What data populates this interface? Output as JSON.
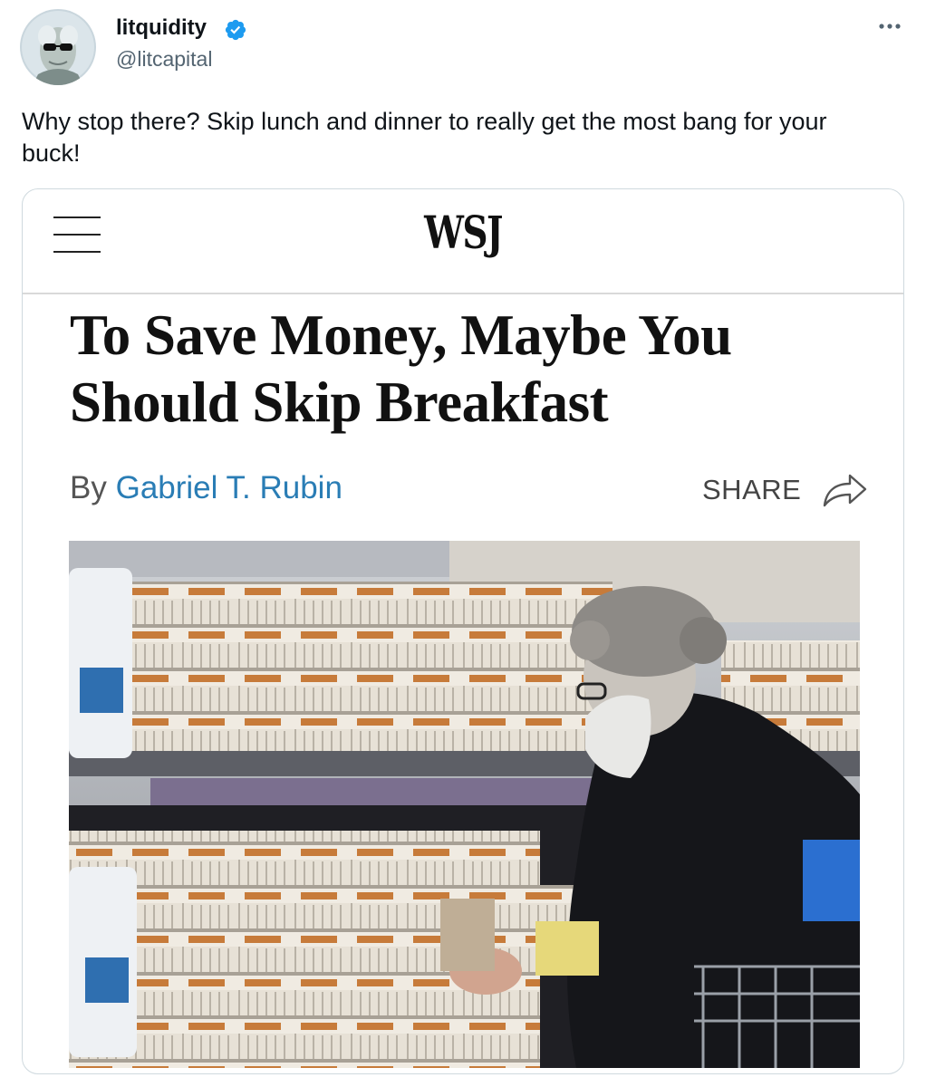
{
  "tweet": {
    "author": {
      "display_name": "litquidity",
      "handle": "@litcapital",
      "verified": true,
      "avatar_icon": "avatar-sunglasses-icon"
    },
    "text": "Why stop there? Skip lunch and dinner to really get the most bang for your buck!",
    "more_icon": "more-options-icon"
  },
  "article_card": {
    "publication": "WSJ",
    "menu_icon": "hamburger-menu-icon",
    "headline": "To Save Money, Maybe You Should Skip Breakfast",
    "byline_prefix": "By",
    "author": "Gabriel T. Rubin",
    "share_label": "SHARE",
    "share_icon": "share-arrow-icon",
    "image_alt": "shopper-choosing-eggs-photo"
  },
  "colors": {
    "text_primary": "#0f1419",
    "text_secondary": "#536471",
    "verified_blue": "#1d9bf0",
    "author_link": "#2a7db5",
    "card_border": "#cfd9de"
  }
}
